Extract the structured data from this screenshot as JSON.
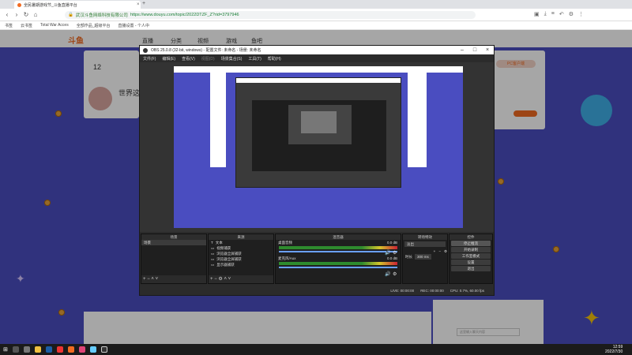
{
  "browser": {
    "tab_title": "全民暑期游戏节_斗鱼直播平台",
    "site_label": "武汉斗鱼网络科技有限公司",
    "url": "https://www.douyu.com/topic/2022DTZF_Z?rid=3797946",
    "bookmarks": [
      "书签",
      "云书签",
      "Total War Acces",
      "全部作品_超级平台",
      "直播设置 - 个人中"
    ]
  },
  "site": {
    "logo": "斗鱼",
    "nav": [
      "直播",
      "分类",
      "视频",
      "游戏",
      "鱼吧"
    ],
    "count": "12",
    "title": "世界这么",
    "pc_button": "PC客户端",
    "chat_placeholder": "这里输入聊天内容"
  },
  "obs": {
    "title": "OBS 25.0.8 (32-bit, windows) - 配置文件: 未命名 - 场景: 未命名",
    "menu": [
      "文件(F)",
      "编辑(E)",
      "查看(V)",
      "视图(D)",
      "场景集合(S)",
      "工具(T)",
      "帮助(H)"
    ],
    "scenes_header": "场景",
    "scene_item": "场景",
    "sources_header": "来源",
    "sources": [
      "文本",
      "视频捕获",
      "浏览器全屏捕获",
      "浏览器全屏捕获",
      "显示器捕获"
    ],
    "mixer_header": "混音器",
    "mixer_channels": [
      {
        "name": "桌面音频",
        "db": "0.0 dB"
      },
      {
        "name": "麦克风/Aux",
        "db": "0.0 dB"
      }
    ],
    "transitions_header": "转场特效",
    "transition_type": "淡出",
    "duration_label": "时长",
    "duration_value": "300 ms",
    "controls_header": "控件",
    "controls": [
      "停止推流",
      "开始录制",
      "工作室模式",
      "设置",
      "退出"
    ],
    "status": {
      "live": "LIVE: 00:00:00",
      "rec": "REC: 00:00:00",
      "cpu": "CPU: 0.7%, 60.00 fps"
    }
  },
  "taskbar": {
    "time": "12:59",
    "date": "2022/7/30"
  },
  "colors": {
    "accent": "#f26b21",
    "page_bg": "#4a4dc0",
    "obs_bg": "#2b2b2b"
  }
}
